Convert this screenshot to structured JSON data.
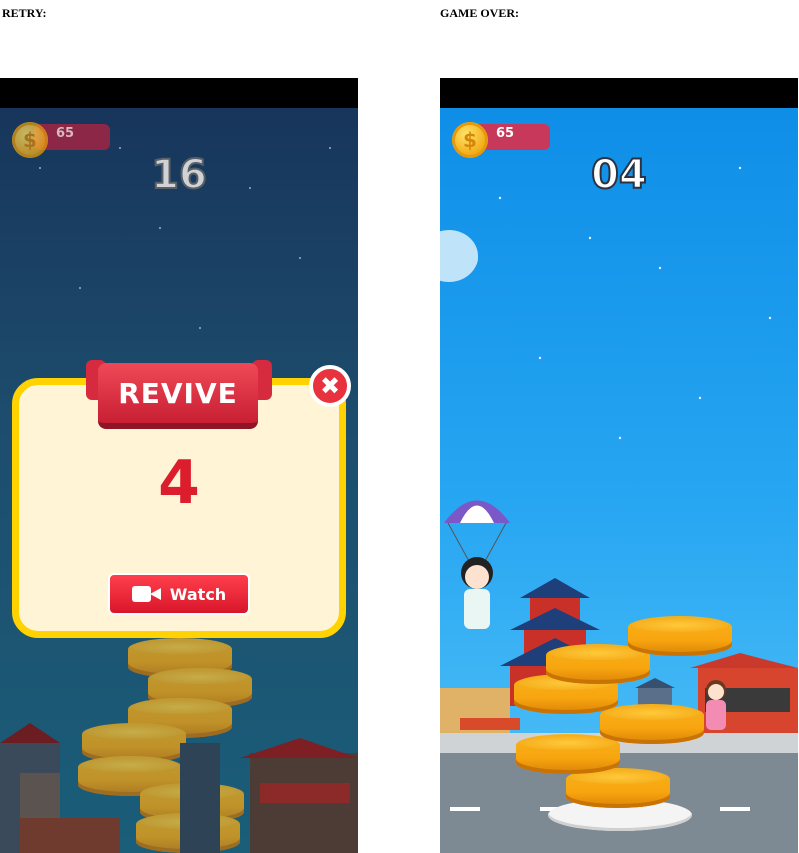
{
  "captions": {
    "retry": "RETRY:",
    "game_over": "GAME OVER:"
  },
  "retry_screen": {
    "coins": "65",
    "score": "16",
    "dialog": {
      "title": "REVIVE",
      "countdown": "4",
      "watch_label": "Watch",
      "close_icon": "close-icon",
      "watch_icon": "video-camera-icon"
    }
  },
  "game_over_screen": {
    "coins": "65",
    "score": "04"
  },
  "colors": {
    "coin_pill": "#c7385a",
    "dialog_border": "#ffd200",
    "dialog_bg": "#fff5d6",
    "accent_red": "#dc1d2d"
  }
}
